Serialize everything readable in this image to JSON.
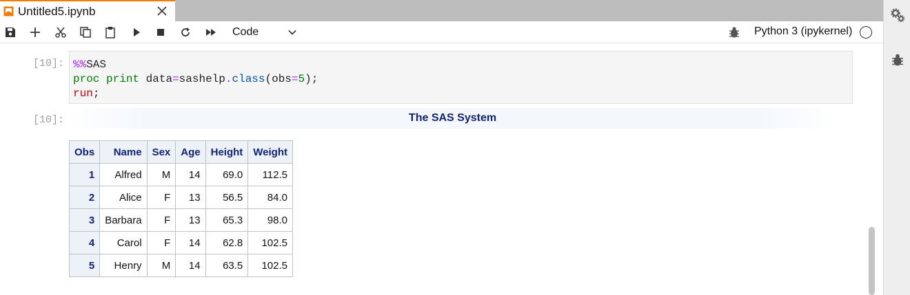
{
  "tab": {
    "title": "Untitled5.ipynb",
    "icon": "notebook-icon"
  },
  "toolbar": {
    "buttons": [
      "save-icon",
      "add-cell-icon",
      "cut-icon",
      "copy-icon",
      "paste-icon",
      "run-icon",
      "stop-icon",
      "restart-icon",
      "fast-forward-icon"
    ],
    "cell_type": "Code",
    "kernel_name": "Python 3 (ipykernel)"
  },
  "cell": {
    "input_prompt": "[10]:",
    "output_prompt": "[10]:",
    "code_lines": [
      [
        {
          "t": "%%",
          "c": "magic"
        },
        {
          "t": "SAS",
          "c": ""
        }
      ],
      [
        {
          "t": "proc",
          "c": "kw"
        },
        {
          "t": " ",
          "c": ""
        },
        {
          "t": "print",
          "c": "kw"
        },
        {
          "t": " data",
          "c": ""
        },
        {
          "t": "=",
          "c": "op"
        },
        {
          "t": "sashelp",
          "c": ""
        },
        {
          "t": ".",
          "c": "op"
        },
        {
          "t": "class",
          "c": "fn"
        },
        {
          "t": "(obs",
          "c": ""
        },
        {
          "t": "=",
          "c": "op"
        },
        {
          "t": "5",
          "c": "num"
        },
        {
          "t": ");",
          "c": ""
        }
      ],
      [
        {
          "t": "run",
          "c": "kwred"
        },
        {
          "t": ";",
          "c": ""
        }
      ]
    ]
  },
  "output": {
    "title": "The SAS System",
    "columns": [
      "Obs",
      "Name",
      "Sex",
      "Age",
      "Height",
      "Weight"
    ],
    "rows": [
      [
        "1",
        "Alfred",
        "M",
        "14",
        "69.0",
        "112.5"
      ],
      [
        "2",
        "Alice",
        "F",
        "13",
        "56.5",
        "84.0"
      ],
      [
        "3",
        "Barbara",
        "F",
        "13",
        "65.3",
        "98.0"
      ],
      [
        "4",
        "Carol",
        "F",
        "14",
        "62.8",
        "102.5"
      ],
      [
        "5",
        "Henry",
        "M",
        "14",
        "63.5",
        "102.5"
      ]
    ]
  },
  "colors": {
    "accent": "#f57c00",
    "sas_header": "#112277",
    "sas_header_bg": "#edf2f9"
  }
}
